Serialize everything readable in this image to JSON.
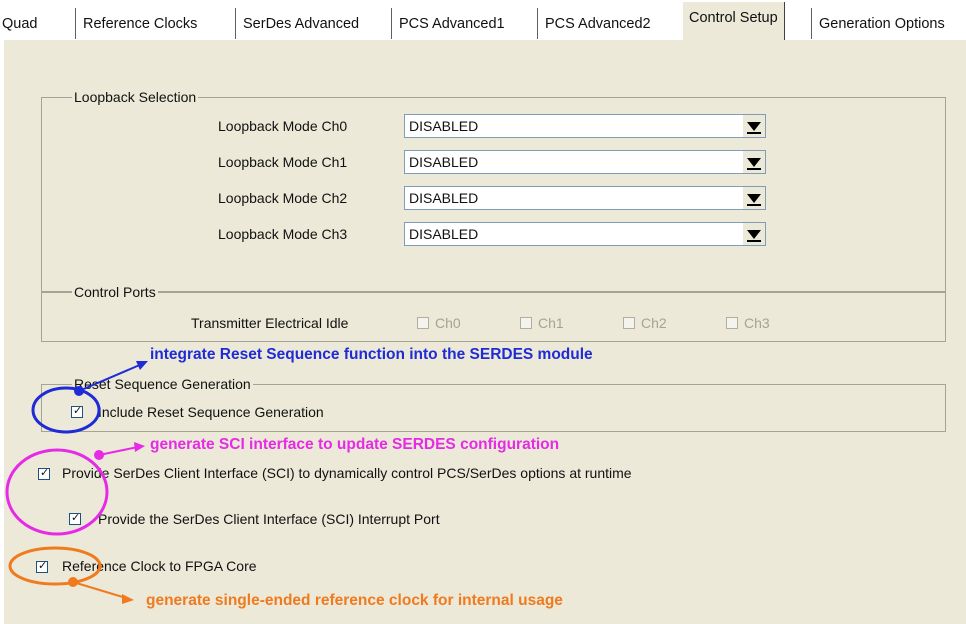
{
  "tabs": [
    {
      "label": "Quad"
    },
    {
      "label": "Reference Clocks"
    },
    {
      "label": "SerDes Advanced"
    },
    {
      "label": "PCS Advanced1"
    },
    {
      "label": "PCS Advanced2"
    },
    {
      "label": "Control Setup"
    },
    {
      "label": "Generation Options"
    }
  ],
  "active_tab": "Control Setup",
  "loopback": {
    "title": "Loopback Selection",
    "rows": [
      {
        "label": "Loopback Mode Ch0",
        "value": "DISABLED"
      },
      {
        "label": "Loopback Mode Ch1",
        "value": "DISABLED"
      },
      {
        "label": "Loopback Mode Ch2",
        "value": "DISABLED"
      },
      {
        "label": "Loopback Mode Ch3",
        "value": "DISABLED"
      }
    ]
  },
  "control_ports": {
    "title": "Control Ports",
    "row_label": "Transmitter Electrical Idle",
    "channels": [
      {
        "label": "Ch0",
        "checked": false
      },
      {
        "label": "Ch1",
        "checked": false
      },
      {
        "label": "Ch2",
        "checked": false
      },
      {
        "label": "Ch3",
        "checked": false
      }
    ]
  },
  "reset_seq": {
    "title": "Reset Sequence Generation",
    "checkbox_label": "Include Reset Sequence Generation",
    "checked": true
  },
  "sci": {
    "label": "Provide SerDes Client Interface (SCI) to dynamically control PCS/SerDes options at runtime",
    "checked": true,
    "interrupt_label": "Provide the SerDes Client Interface (SCI) Interrupt Port",
    "interrupt_checked": true
  },
  "refclk": {
    "label": "Reference Clock to FPGA Core",
    "checked": true
  },
  "annotations": {
    "reset": "integrate Reset Sequence function into the SERDES module",
    "sci": "generate SCI interface to update SERDES configuration",
    "refclk": "generate single-ended reference clock for internal usage"
  },
  "colors": {
    "reset_annotation": "#1f2bd6",
    "sci_annotation": "#e62ae6",
    "refclk_annotation": "#f07a1e",
    "panel_bg": "#ece9d8"
  },
  "checkmark": "✓"
}
